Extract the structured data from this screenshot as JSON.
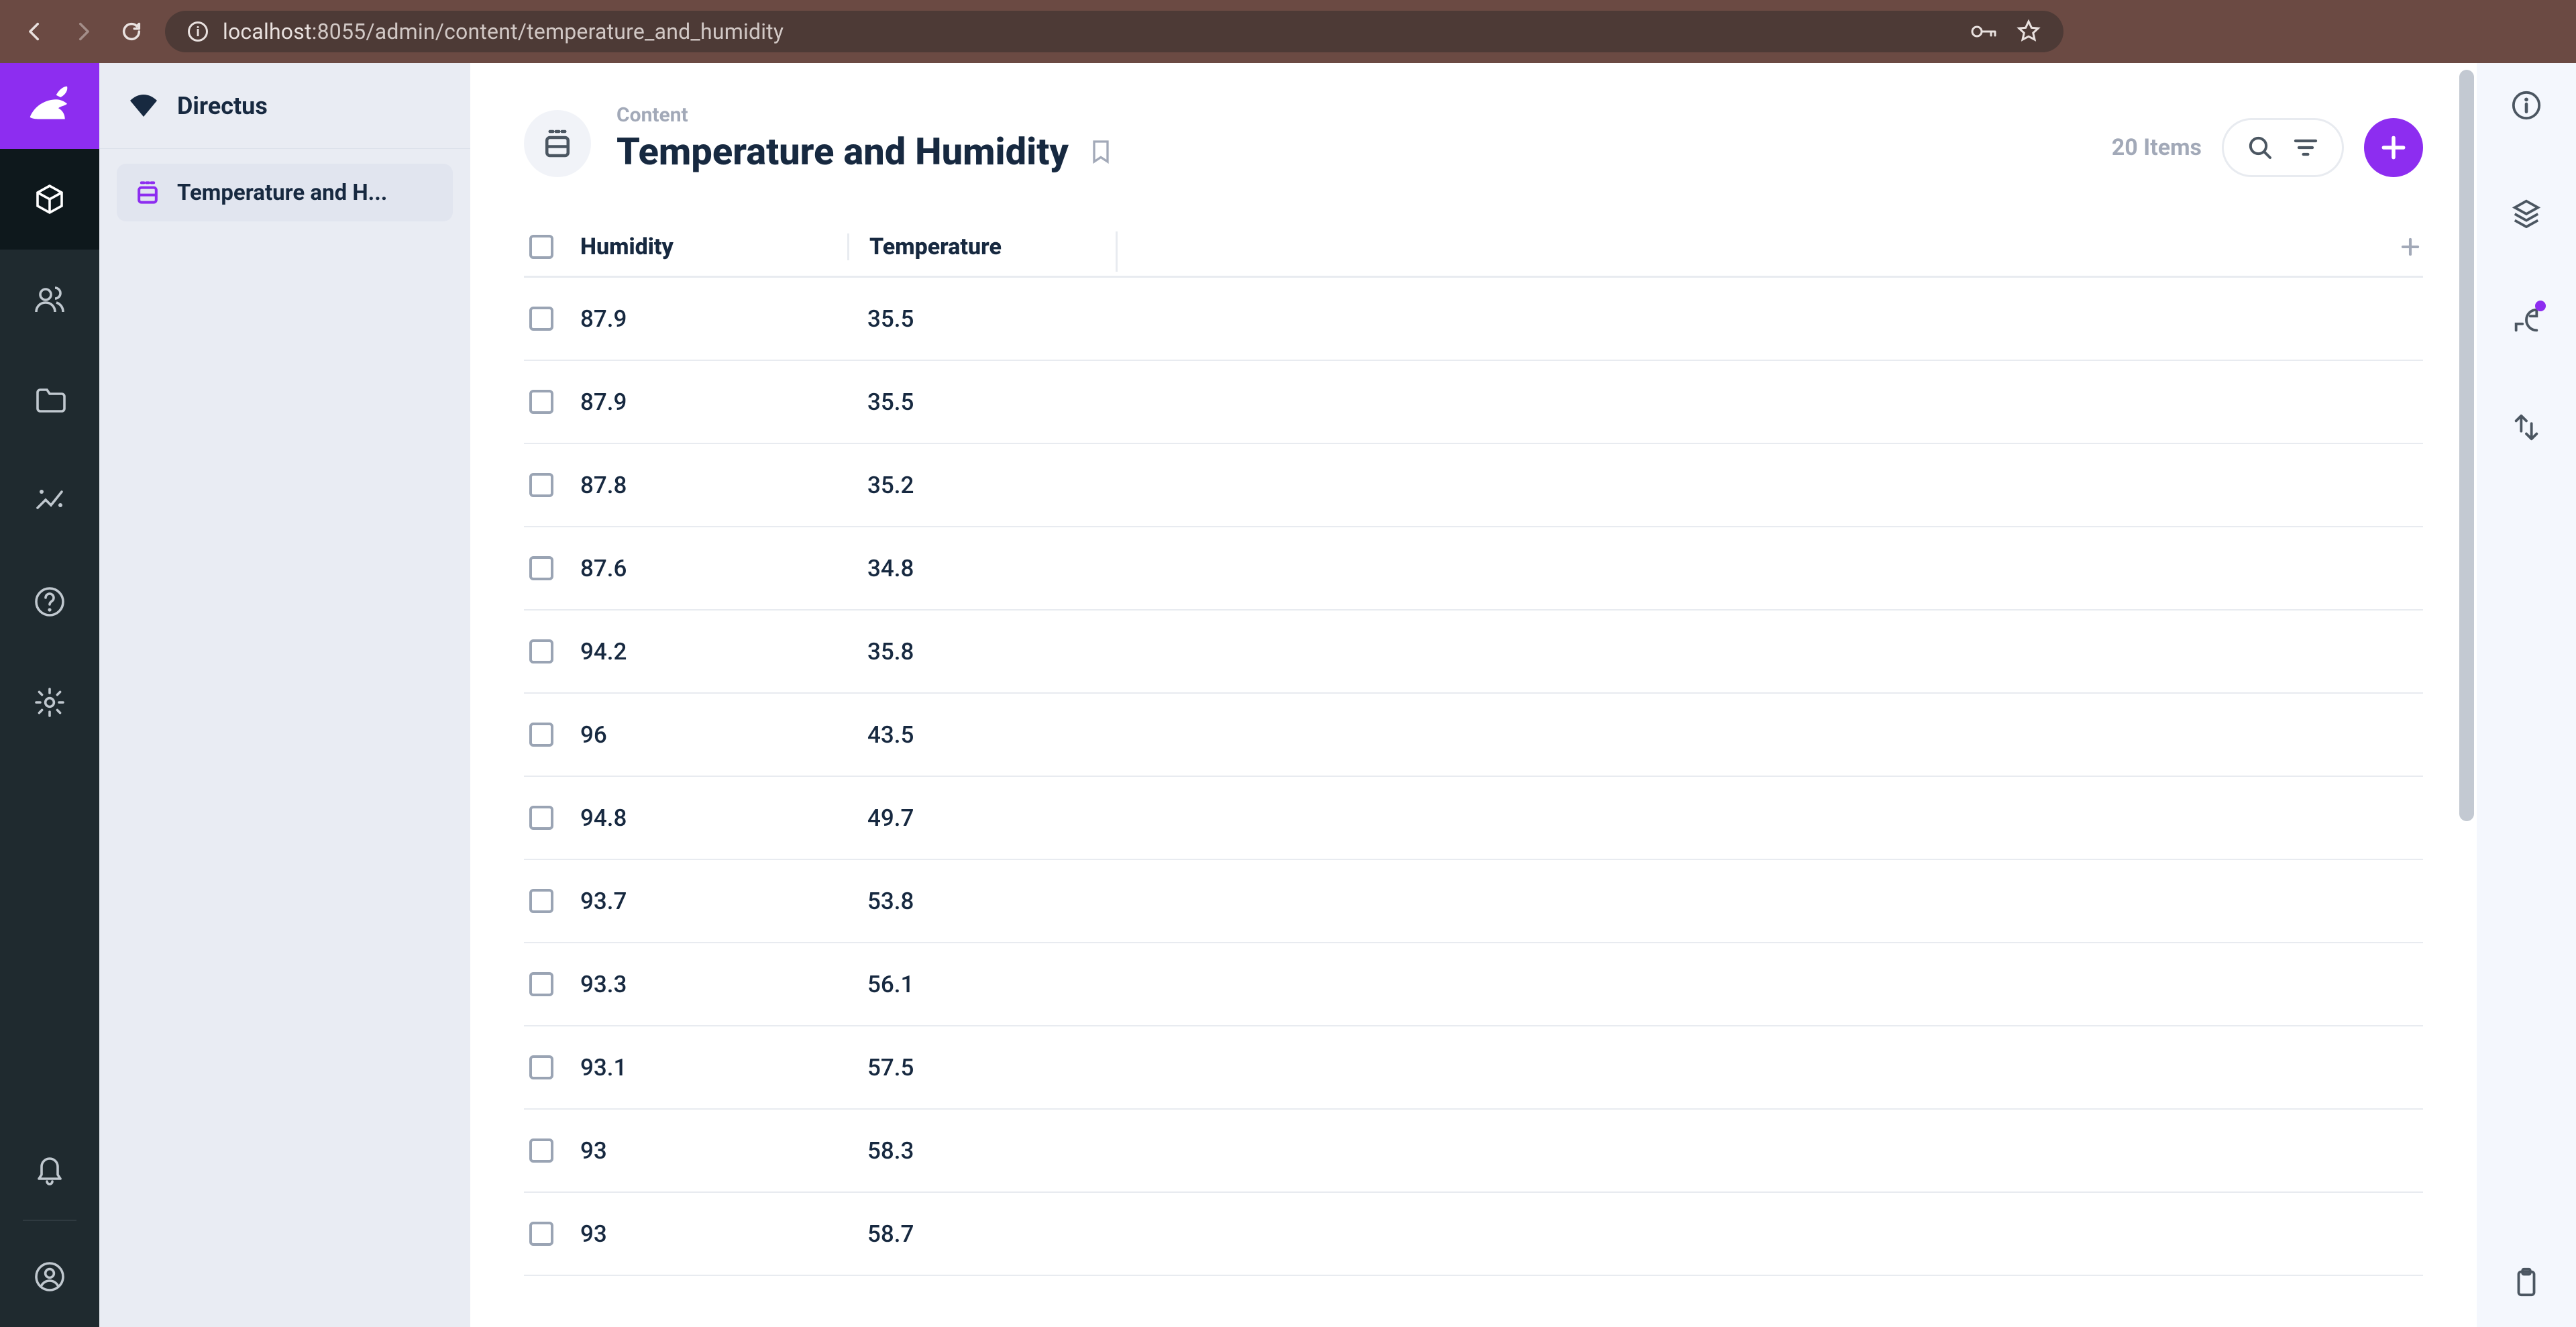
{
  "browser": {
    "url_host": "localhost",
    "url_path": ":8055/admin/content/temperature_and_humidity"
  },
  "app": {
    "brand": "Directus"
  },
  "sidebar": {
    "items": [
      {
        "label": "Temperature and H...",
        "icon": "sensor"
      }
    ]
  },
  "header": {
    "breadcrumb": "Content",
    "title": "Temperature and Humidity",
    "item_count": "20 Items"
  },
  "table": {
    "columns": [
      {
        "key": "humidity",
        "label": "Humidity"
      },
      {
        "key": "temperature",
        "label": "Temperature"
      }
    ],
    "rows": [
      {
        "humidity": "87.9",
        "temperature": "35.5"
      },
      {
        "humidity": "87.9",
        "temperature": "35.5"
      },
      {
        "humidity": "87.8",
        "temperature": "35.2"
      },
      {
        "humidity": "87.6",
        "temperature": "34.8"
      },
      {
        "humidity": "94.2",
        "temperature": "35.8"
      },
      {
        "humidity": "96",
        "temperature": "43.5"
      },
      {
        "humidity": "94.8",
        "temperature": "49.7"
      },
      {
        "humidity": "93.7",
        "temperature": "53.8"
      },
      {
        "humidity": "93.3",
        "temperature": "56.1"
      },
      {
        "humidity": "93.1",
        "temperature": "57.5"
      },
      {
        "humidity": "93",
        "temperature": "58.3"
      },
      {
        "humidity": "93",
        "temperature": "58.7"
      }
    ]
  }
}
